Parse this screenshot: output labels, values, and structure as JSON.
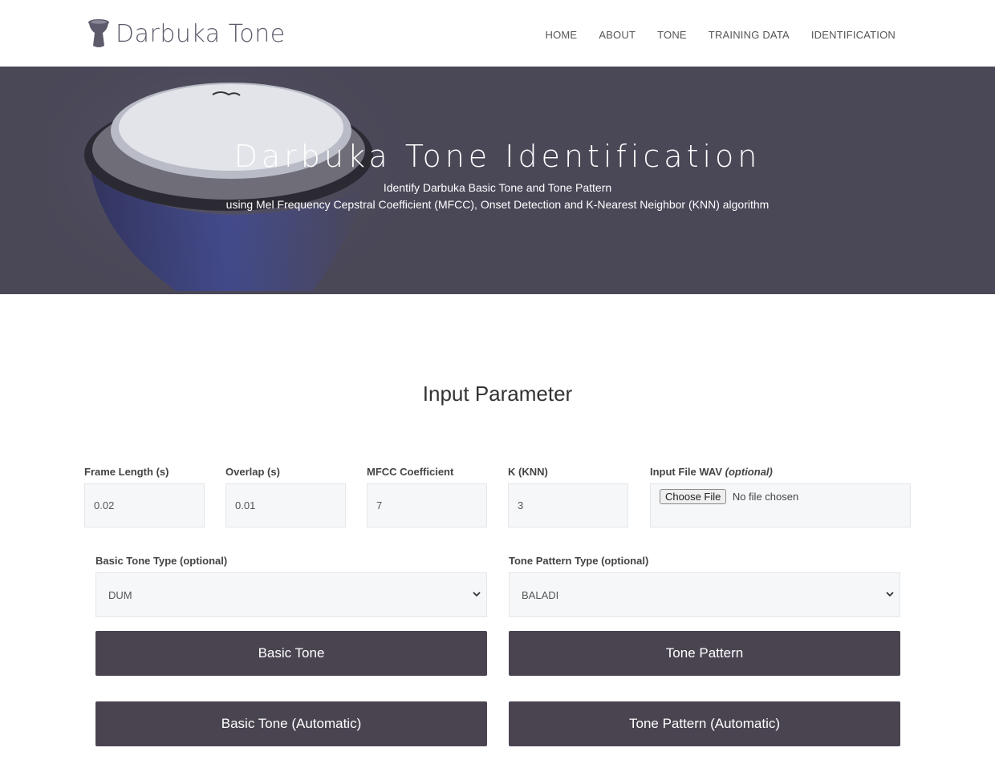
{
  "brand": {
    "name": "Darbuka Tone"
  },
  "nav": {
    "items": [
      "HOME",
      "ABOUT",
      "TONE",
      "TRAINING DATA",
      "IDENTIFICATION"
    ]
  },
  "hero": {
    "title": "Darbuka Tone Identification",
    "subtitle_line1": "Identify Darbuka Basic Tone and Tone Pattern",
    "subtitle_line2": "using Mel Frequency Cepstral Coefficient (MFCC), Onset Detection and K-Nearest Neighbor (KNN) algorithm"
  },
  "section": {
    "title": "Input Parameter"
  },
  "fields": {
    "frame_length": {
      "label": "Frame Length (s)",
      "value": "0.02"
    },
    "overlap": {
      "label": "Overlap (s)",
      "value": "0.01"
    },
    "mfcc": {
      "label": "MFCC Coefficient",
      "value": "7"
    },
    "k": {
      "label": "K (KNN)",
      "value": "3"
    },
    "file": {
      "label": "Input File WAV",
      "label_optional": "(optional)",
      "button": "Choose File",
      "status": "No file chosen"
    }
  },
  "selects": {
    "basic_tone": {
      "label": "Basic Tone Type (optional)",
      "value": "DUM"
    },
    "tone_pattern": {
      "label": "Tone Pattern Type (optional)",
      "value": "BALADI"
    }
  },
  "buttons": {
    "basic_tone": "Basic Tone",
    "tone_pattern": "Tone Pattern",
    "basic_tone_auto": "Basic Tone (Automatic)",
    "tone_pattern_auto": "Tone Pattern (Automatic)"
  },
  "colors": {
    "hero_bg": "#4a4757",
    "button_bg": "#4a4451",
    "brand": "#5d5a6b"
  }
}
